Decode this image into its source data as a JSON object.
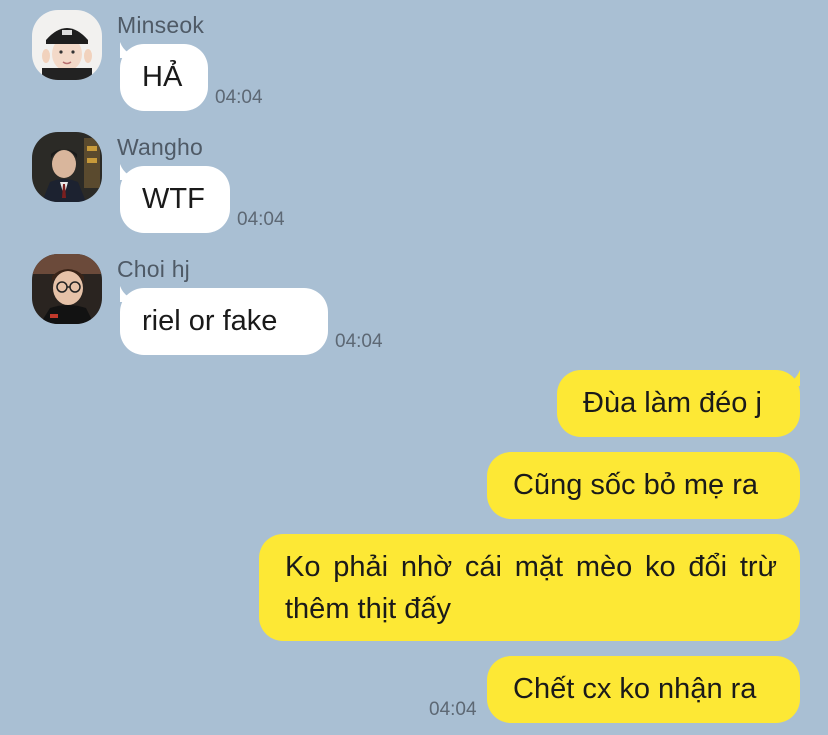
{
  "messages_in": [
    {
      "sender": "Minseok",
      "text": "HẢ",
      "time": "04:04",
      "avatar": "avatar-minseok"
    },
    {
      "sender": "Wangho",
      "text": "WTF",
      "time": "04:04",
      "avatar": "avatar-wangho"
    },
    {
      "sender": "Choi hj",
      "text": "riel or fake",
      "time": "04:04",
      "avatar": "avatar-choihj"
    }
  ],
  "messages_out": [
    {
      "text": "Đùa làm đéo j"
    },
    {
      "text": "Cũng sốc bỏ mẹ ra"
    },
    {
      "text": "Ko phải nhờ cái mặt mèo ko đổi trừ thêm thịt đấy"
    },
    {
      "text": "Chết cx ko nhận ra",
      "time": "04:04"
    }
  ],
  "colors": {
    "background": "#a9bfd3",
    "incoming_bubble": "#ffffff",
    "outgoing_bubble": "#fde835",
    "sender_name": "#4f5a66",
    "timestamp": "#5d6874"
  }
}
